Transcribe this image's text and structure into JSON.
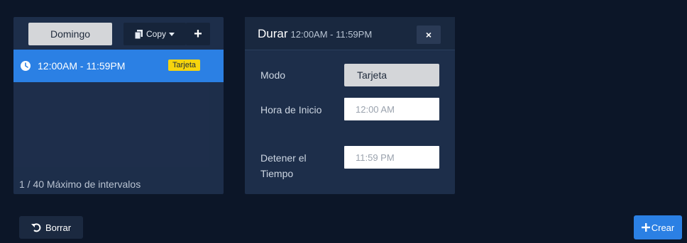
{
  "schedule": {
    "day_label": "Domingo",
    "copy_label": "Copy",
    "add_symbol": "+",
    "intervals": [
      {
        "time": "12:00AM - 11:59PM",
        "badge": "Tarjeta"
      }
    ],
    "max_intervals_text": "1 / 40 Máximo de intervalos"
  },
  "detail": {
    "title": "Durar",
    "range": "12:00AM - 11:59PM",
    "close_symbol": "×",
    "mode_label": "Modo",
    "mode_value": "Tarjeta",
    "start_label": "Hora de Inicio",
    "start_value": "12:00 AM",
    "stop_label": "Detener el Tiempo",
    "stop_value": "11:59 PM"
  },
  "footer": {
    "reset_label": "Borrar",
    "create_label": "Crear"
  },
  "colors": {
    "background": "#0c1628",
    "panel": "#1d2e4a",
    "accent": "#2b80e4",
    "badge": "#f6d40e"
  },
  "icons": [
    "copy-icon",
    "caret-down-icon",
    "plus-icon",
    "clock-icon",
    "close-icon",
    "undo-icon"
  ]
}
